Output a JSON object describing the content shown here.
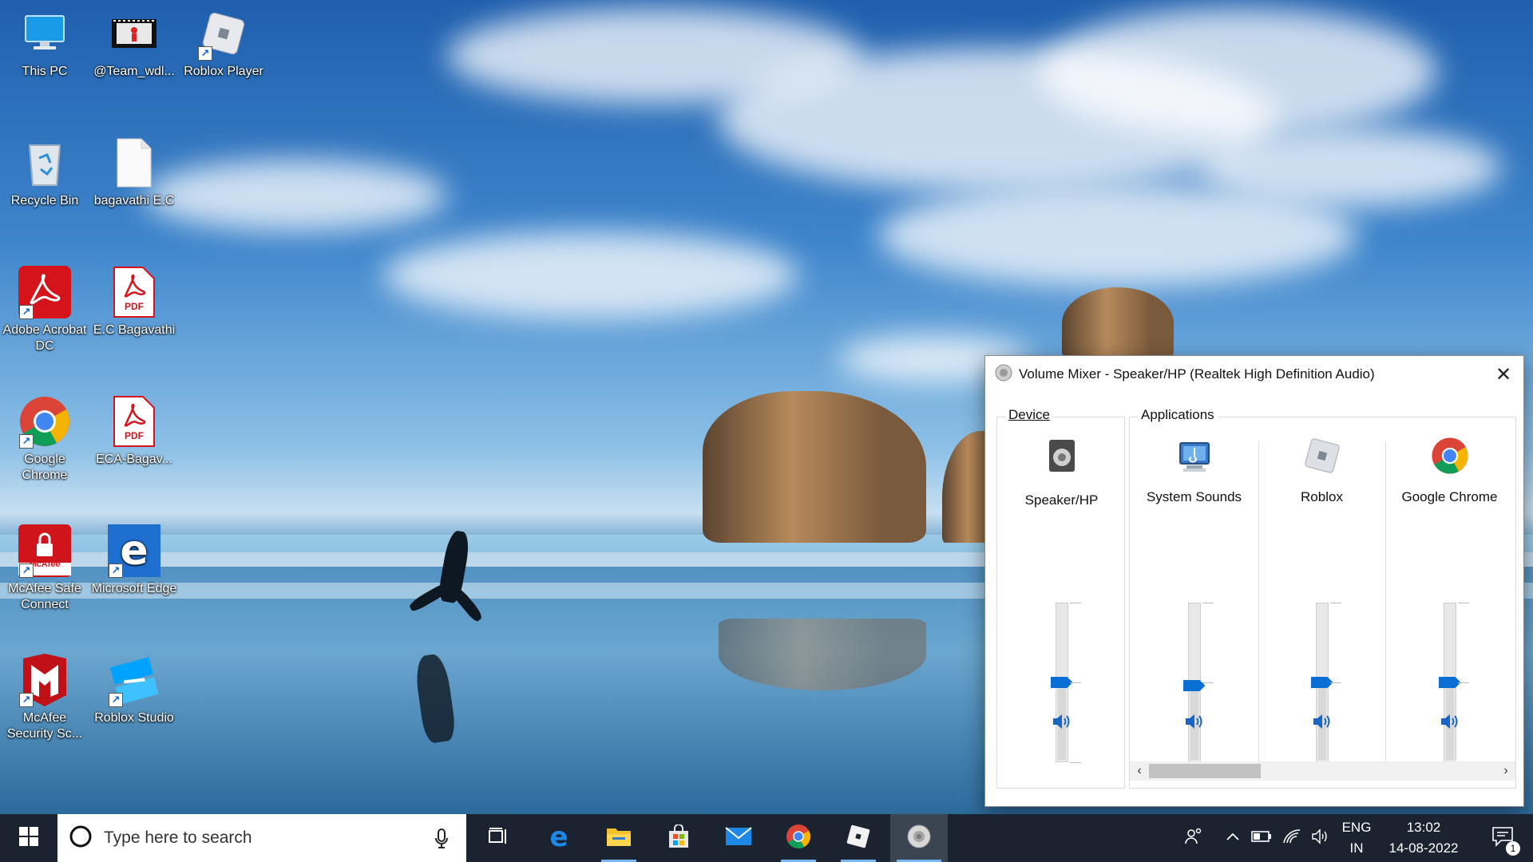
{
  "desktop": {
    "icons": [
      {
        "label": "This PC"
      },
      {
        "label": "@Team_wdl..."
      },
      {
        "label": "Roblox Player"
      },
      {
        "label": "Recycle Bin"
      },
      {
        "label": "bagavathi E.C"
      },
      {
        "label": "Adobe Acrobat DC"
      },
      {
        "label": "E.C Bagavathi"
      },
      {
        "label": "Google Chrome"
      },
      {
        "label": "ECA-Bagav..."
      },
      {
        "label": "McAfee Safe Connect"
      },
      {
        "label": "Microsoft Edge"
      },
      {
        "label": "McAfee Security Sc..."
      },
      {
        "label": "Roblox Studio"
      }
    ],
    "pdf_badge": "PDF",
    "mcafee_badge": "McAfee"
  },
  "mixer": {
    "title": "Volume Mixer - Speaker/HP (Realtek High Definition Audio)",
    "device_group": "Device",
    "applications_group": "Applications",
    "device": {
      "name": "Speaker/HP",
      "level": 0.5
    },
    "apps": [
      {
        "name": "System Sounds",
        "level": 0.48
      },
      {
        "name": "Roblox",
        "level": 0.5
      },
      {
        "name": "Google Chrome",
        "level": 0.5
      }
    ],
    "accent": "#0a6fd4"
  },
  "taskbar": {
    "search_placeholder": "Type here to search",
    "lang_top": "ENG",
    "lang_bottom": "IN",
    "time": "13:02",
    "date": "14-08-2022",
    "notification_count": "1"
  }
}
